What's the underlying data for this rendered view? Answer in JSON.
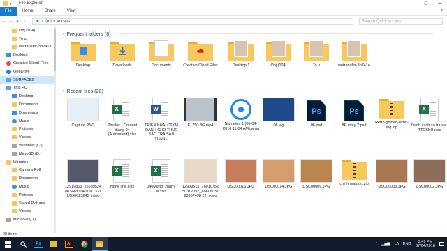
{
  "window": {
    "title": "File Explorer",
    "buttons": [
      "—",
      "☐",
      "✕"
    ]
  },
  "ribbon": {
    "tabs": [
      "File",
      "Home",
      "Share",
      "View"
    ]
  },
  "address": {
    "path": "Quick access",
    "search_placeholder": "Search Quick access"
  },
  "navpane": {
    "items": [
      {
        "label": "Obj (104)",
        "icon": "folder-icon",
        "level": 1
      },
      {
        "label": "To u",
        "icon": "folder-icon",
        "level": 1
      },
      {
        "label": "wetransfer-3b741e",
        "icon": "folder-icon",
        "level": 1
      },
      {
        "label": "Desktop",
        "icon": "desktop-icon",
        "level": 0
      },
      {
        "label": "Creative Cloud Files",
        "icon": "creative-cloud-icon",
        "level": 0
      },
      {
        "label": "OneDrive",
        "icon": "onedrive-icon",
        "level": 0
      },
      {
        "label": "SURFACE2",
        "icon": "user-icon",
        "level": 0,
        "selected": true
      },
      {
        "label": "This PC",
        "icon": "this-pc-icon",
        "level": 0
      },
      {
        "label": "Desktop",
        "icon": "desktop-icon",
        "level": 1
      },
      {
        "label": "Documents",
        "icon": "documents-icon",
        "level": 1
      },
      {
        "label": "Downloads",
        "icon": "downloads-icon",
        "level": 1
      },
      {
        "label": "Music",
        "icon": "music-icon",
        "level": 1
      },
      {
        "label": "Pictures",
        "icon": "pictures-icon",
        "level": 1
      },
      {
        "label": "Videos",
        "icon": "videos-icon",
        "level": 1
      },
      {
        "label": "Windows (C:)",
        "icon": "drive-icon",
        "level": 1
      },
      {
        "label": "MicroSD (D:)",
        "icon": "drive-icon",
        "level": 1
      },
      {
        "label": "Libraries",
        "icon": "libraries-icon",
        "level": 0
      },
      {
        "label": "Camera Roll",
        "icon": "folder-icon",
        "level": 1
      },
      {
        "label": "Documents",
        "icon": "documents-icon",
        "level": 1
      },
      {
        "label": "Music",
        "icon": "music-icon",
        "level": 1
      },
      {
        "label": "Pictures",
        "icon": "pictures-icon",
        "level": 1
      },
      {
        "label": "Saved Pictures",
        "icon": "folder-icon",
        "level": 1
      },
      {
        "label": "Videos",
        "icon": "videos-icon",
        "level": 1
      },
      {
        "label": "MicroSD (D:)",
        "icon": "drive-icon",
        "level": 0
      }
    ]
  },
  "frequent": {
    "header": "Frequent folders (8)",
    "items": [
      {
        "label": "Desktop",
        "kind": "desktop"
      },
      {
        "label": "Downloads",
        "kind": "downloads"
      },
      {
        "label": "Documents",
        "kind": "documents"
      },
      {
        "label": "Creative Cloud Files",
        "kind": "cc"
      },
      {
        "label": "Desktop 1",
        "kind": "pics"
      },
      {
        "label": "Obj (104)",
        "kind": "pics"
      },
      {
        "label": "To u",
        "kind": "pics"
      },
      {
        "label": "wetransfer-3b741e",
        "kind": "pics"
      }
    ]
  },
  "recent": {
    "header": "Recent files (20)",
    "items": [
      {
        "label": "Capture.PNG",
        "kind": "image",
        "color": "#e8eef6"
      },
      {
        "label": "Phu luc - Content thang 04 (Autosaved).xlsx",
        "kind": "excel"
      },
      {
        "label": "TRIỂN KHAI CTKM DÀNH CHO THUÊ BAO TRẢ SAU THÁN...",
        "kind": "word"
      },
      {
        "label": "E1750 3G.mp4",
        "kind": "video",
        "color": "#b9c4cc"
      },
      {
        "label": "Narration 1 (06-04-2016 11-04 AM).wma",
        "kind": "audio"
      },
      {
        "label": "06.jpg",
        "kind": "image",
        "color": "#1e4a8a"
      },
      {
        "label": "06.psd",
        "kind": "psd"
      },
      {
        "label": "8P story 2.psd",
        "kind": "psd"
      },
      {
        "label": "Retro-golden-letter-ing.zip",
        "kind": "zip"
      },
      {
        "label": "Danh sach so tra sau TTCSKH.xlsx",
        "kind": "excel"
      },
      {
        "label": "12919803_25639524803448014019173312/590023245_n.jpg",
        "kind": "image",
        "color": "#55596a"
      },
      {
        "label": "Nghe line.xlsx",
        "kind": "excel"
      },
      {
        "label": "040Mettb_zhanV N.xlsx",
        "kind": "excel"
      },
      {
        "label": "12909515_1601075250312097_6880603793987498 22_o.jpg",
        "kind": "image",
        "color": "#e7d8c8"
      },
      {
        "label": "DSC00016.JPG",
        "kind": "image",
        "color": "#c77d5b"
      },
      {
        "label": "DSC00014.JPG",
        "kind": "image",
        "color": "#d59c6c"
      },
      {
        "label": "DSC00009.JPG",
        "kind": "image",
        "color": "#b9864f"
      },
      {
        "label": "chinh mau do.zip",
        "kind": "zip"
      },
      {
        "label": "DSC00005.JPG",
        "kind": "image",
        "color": "#a97852"
      },
      {
        "label": "DSC00002.JPG",
        "kind": "image",
        "color": "#8e6e58"
      }
    ]
  },
  "status": {
    "text": "20 items"
  },
  "taskbar": {
    "icons": [
      "windows-start-icon",
      "search-icon",
      "photoshop-icon",
      "files-icon",
      "illustrator-icon",
      "chrome-icon",
      "file-explorer-icon"
    ],
    "tray_lang": "ENG",
    "time": "3:49 PM",
    "date": "07/04/2016"
  },
  "colors": {
    "accent": "#1979ca",
    "taskbar": "#101b2b",
    "selection": "#cce8ff"
  }
}
